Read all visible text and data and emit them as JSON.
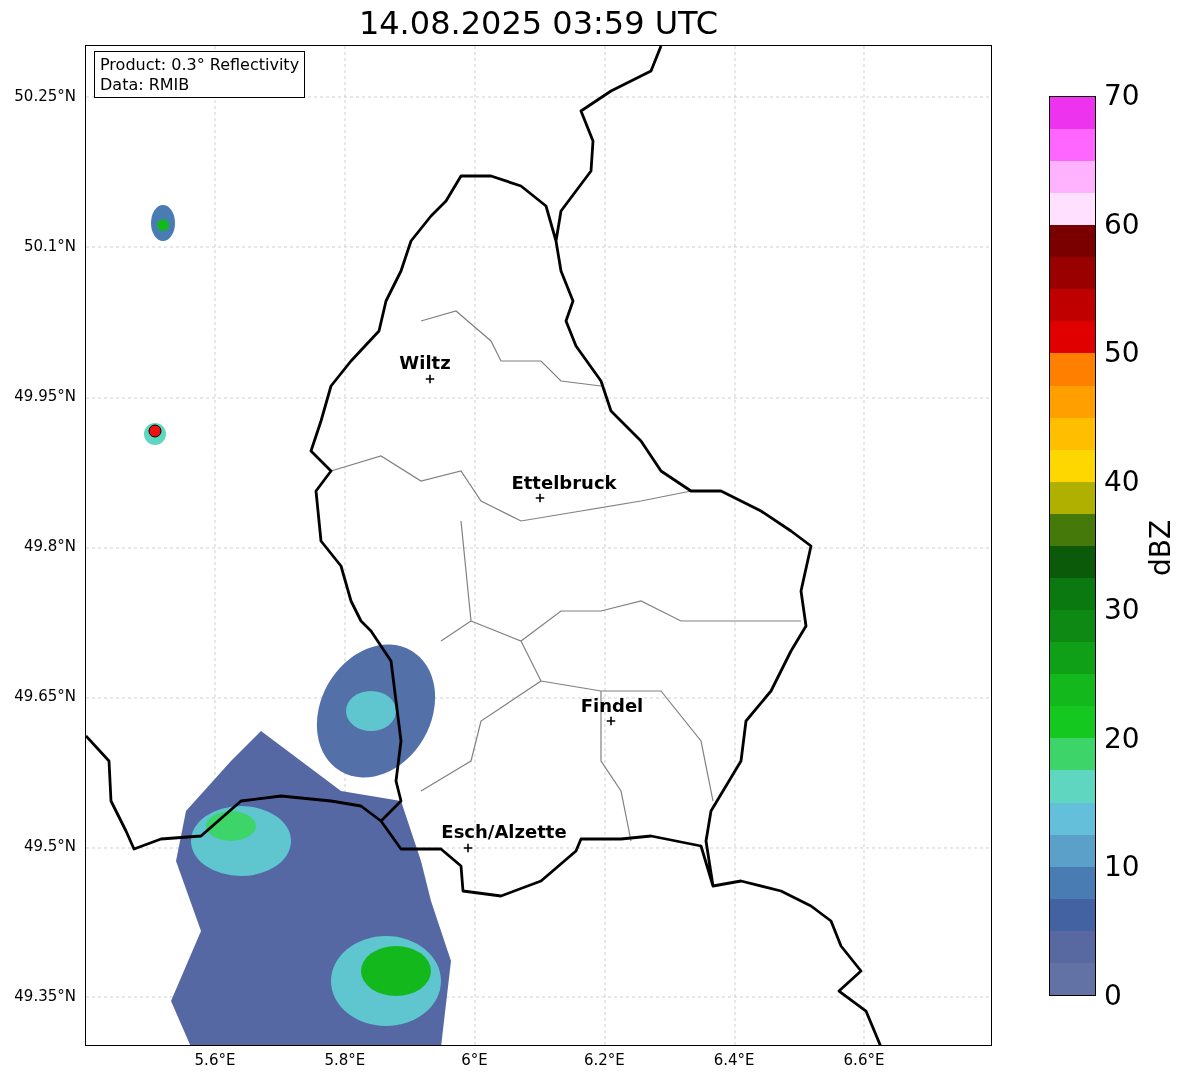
{
  "title": "14.08.2025 03:59 UTC",
  "legend": [
    "Product: 0.3° Reflectivity",
    "Data: RMIB"
  ],
  "map": {
    "places": [
      {
        "name": "Wiltz"
      },
      {
        "name": "Ettelbruck"
      },
      {
        "name": "Findel"
      },
      {
        "name": "Esch/Alzette"
      }
    ],
    "y_ticks": [
      "50.25°N",
      "50.1°N",
      "49.95°N",
      "49.8°N",
      "49.65°N",
      "49.5°N",
      "49.35°N"
    ],
    "x_ticks": [
      "5.6°E",
      "5.8°E",
      "6°E",
      "6.2°E",
      "6.4°E",
      "6.6°E"
    ]
  },
  "colorbar": {
    "label": "dBZ",
    "ticks": [
      "70",
      "60",
      "50",
      "40",
      "30",
      "20",
      "10",
      "0"
    ],
    "bands": [
      {
        "color": "#6272a4"
      },
      {
        "color": "#5868a0"
      },
      {
        "color": "#4262a2"
      },
      {
        "color": "#4a7cb4"
      },
      {
        "color": "#5aa0c8"
      },
      {
        "color": "#64c0da"
      },
      {
        "color": "#5fd6c0"
      },
      {
        "color": "#3dd56a"
      },
      {
        "color": "#14c81f"
      },
      {
        "color": "#12b81c"
      },
      {
        "color": "#10a018"
      },
      {
        "color": "#0e8a14"
      },
      {
        "color": "#0a7a10"
      },
      {
        "color": "#0a5a0a"
      },
      {
        "color": "#457a0a"
      },
      {
        "color": "#b0b000"
      },
      {
        "color": "#ffd700"
      },
      {
        "color": "#ffbf00"
      },
      {
        "color": "#ff9f00"
      },
      {
        "color": "#ff7f00"
      },
      {
        "color": "#e00000"
      },
      {
        "color": "#c00000"
      },
      {
        "color": "#9a0000"
      },
      {
        "color": "#7a0000"
      },
      {
        "color": "#ffe0ff"
      },
      {
        "color": "#ffb3ff"
      },
      {
        "color": "#ff66ff"
      },
      {
        "color": "#ee33ee"
      }
    ]
  }
}
